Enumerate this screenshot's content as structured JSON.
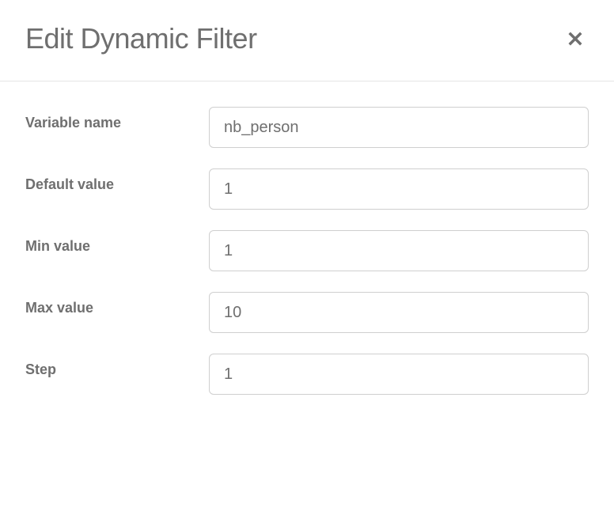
{
  "dialog": {
    "title": "Edit Dynamic Filter"
  },
  "form": {
    "variable_name": {
      "label": "Variable name",
      "value": "nb_person"
    },
    "default_value": {
      "label": "Default value",
      "value": "1"
    },
    "min_value": {
      "label": "Min value",
      "value": "1"
    },
    "max_value": {
      "label": "Max value",
      "value": "10"
    },
    "step": {
      "label": "Step",
      "value": "1"
    }
  }
}
